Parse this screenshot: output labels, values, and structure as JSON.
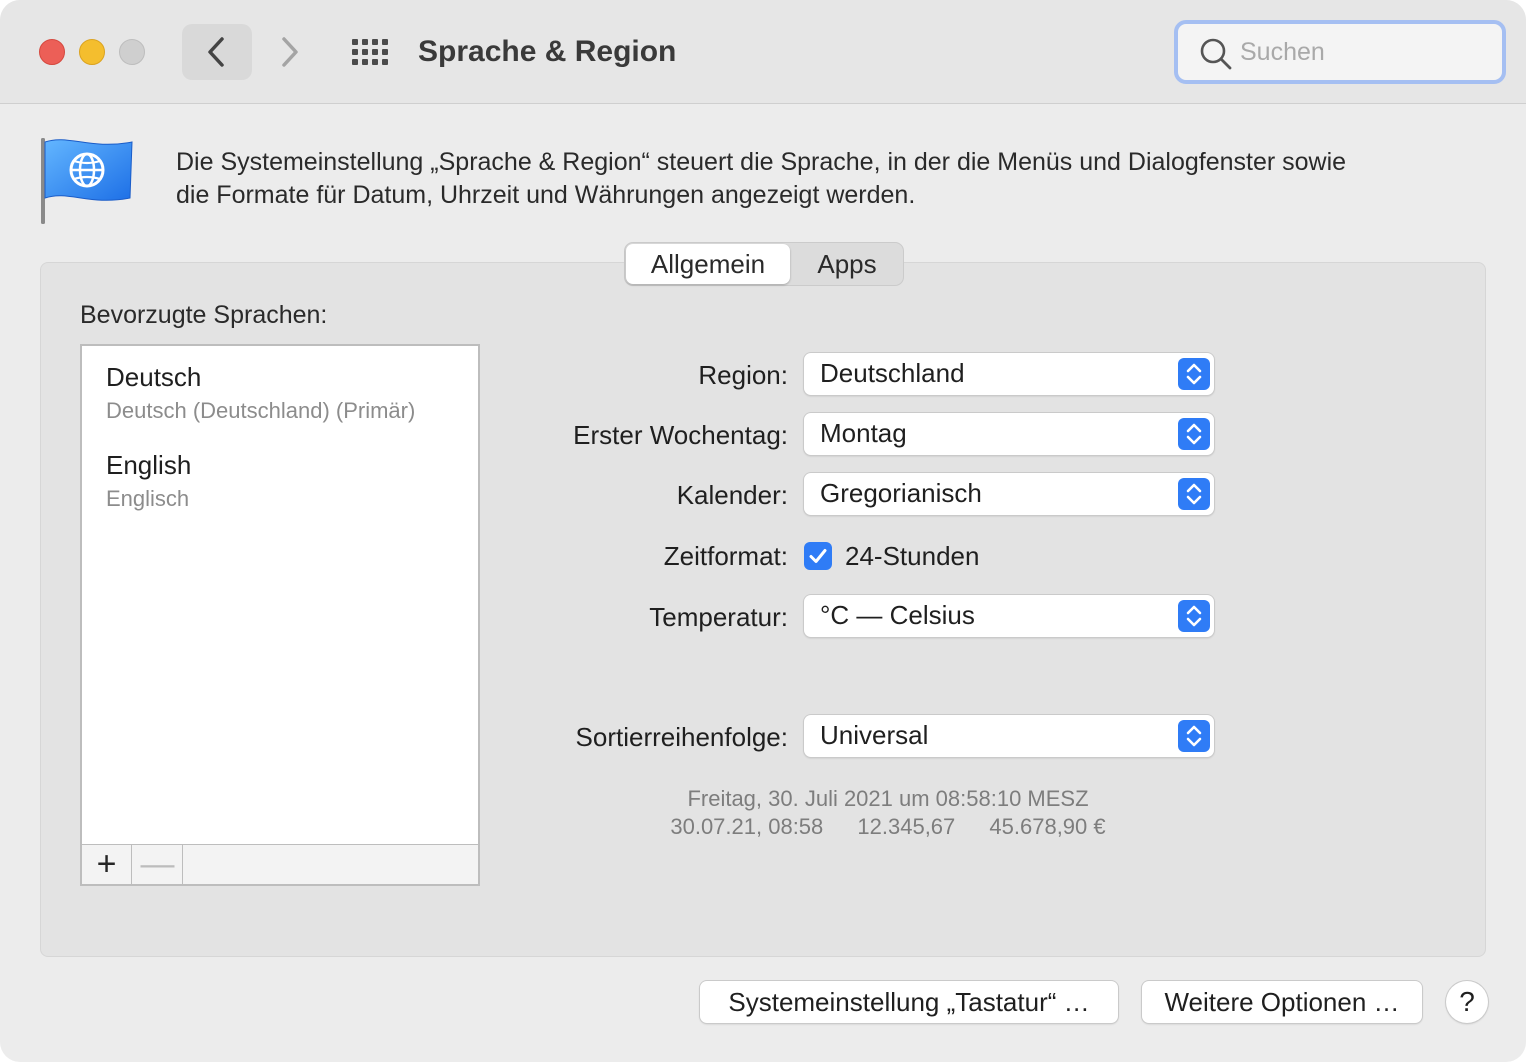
{
  "window": {
    "title": "Sprache & Region"
  },
  "search": {
    "placeholder": "Suchen"
  },
  "header": {
    "description_line1": "Die Systemeinstellung „Sprache & Region“ steuert die Sprache, in der die Menüs und Dialogfenster sowie",
    "description_line2": "die Formate für Datum, Uhrzeit und Währungen angezeigt werden.",
    "icon": "flag-globe-icon"
  },
  "tabs": [
    {
      "label": "Allgemein",
      "selected": true
    },
    {
      "label": "Apps",
      "selected": false
    }
  ],
  "languages": {
    "label": "Bevorzugte Sprachen:",
    "items": [
      {
        "name": "Deutsch",
        "subtitle": "Deutsch (Deutschland) (Primär)"
      },
      {
        "name": "English",
        "subtitle": "Englisch"
      }
    ],
    "add_label": "+",
    "remove_label": "—"
  },
  "form": {
    "region": {
      "label": "Region:",
      "value": "Deutschland"
    },
    "first_weekday": {
      "label": "Erster Wochentag:",
      "value": "Montag"
    },
    "calendar": {
      "label": "Kalender:",
      "value": "Gregorianisch"
    },
    "time_format": {
      "label": "Zeitformat:",
      "checkbox_label": "24-Stunden",
      "checked": true
    },
    "temperature": {
      "label": "Temperatur:",
      "value": "°C — Celsius"
    },
    "sort_order": {
      "label": "Sortierreihenfolge:",
      "value": "Universal"
    }
  },
  "sample": {
    "datetime": "Freitag, 30. Juli 2021 um 08:58:10 MESZ",
    "short_date": "30.07.21, 08:58",
    "number": "12.345,67",
    "currency": "45.678,90 €"
  },
  "buttons": {
    "keyboard": "Systemeinstellung „Tastatur“ …",
    "more_options": "Weitere Optionen …",
    "help": "?"
  },
  "colors": {
    "accent": "#2f7cf6",
    "close": "#ec5f57",
    "minimize": "#f4be2e",
    "search_focus": "#a5bff2"
  }
}
